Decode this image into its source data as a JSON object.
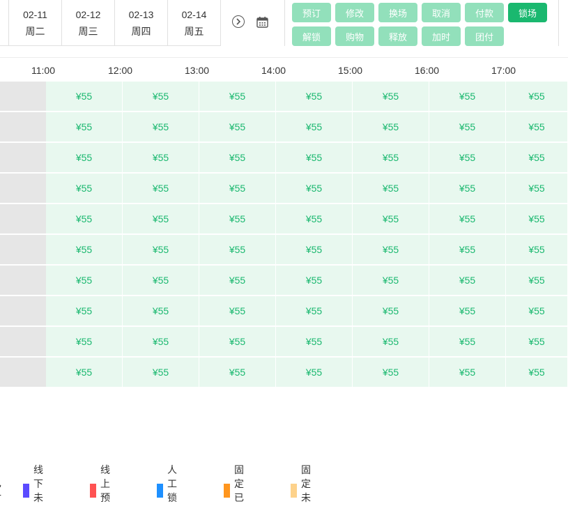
{
  "dates": [
    {
      "date": "02-11",
      "weekday": "周二"
    },
    {
      "date": "02-12",
      "weekday": "周三"
    },
    {
      "date": "02-13",
      "weekday": "周四"
    },
    {
      "date": "02-14",
      "weekday": "周五"
    }
  ],
  "nav": {
    "next_icon": "chevron-right-circle-icon",
    "calendar_icon": "calendar-icon"
  },
  "actions": {
    "row1": [
      "预订",
      "修改",
      "换场",
      "取消",
      "付款",
      "锁场"
    ],
    "row2": [
      "解锁",
      "购物",
      "释放",
      "加时",
      "团付"
    ],
    "active": "锁场",
    "colors": {
      "normal": "#92e0bb",
      "active": "#1ab86f"
    }
  },
  "times": [
    "11:00",
    "12:00",
    "13:00",
    "14:00",
    "15:00",
    "16:00",
    "17:00"
  ],
  "price": "¥55",
  "row_count": 10,
  "slot_color": "#e8f8ef",
  "price_color": "#1ab86f",
  "legend": [
    {
      "label": "已付",
      "color": ""
    },
    {
      "label": "线下未付",
      "color": "#5b4bff"
    },
    {
      "label": "线上预订",
      "color": "#ff5252"
    },
    {
      "label": "人工锁场",
      "color": "#1e90ff"
    },
    {
      "label": "固定已付",
      "color": "#ff961e"
    },
    {
      "label": "固定未付",
      "color": "#fdd28b"
    }
  ]
}
